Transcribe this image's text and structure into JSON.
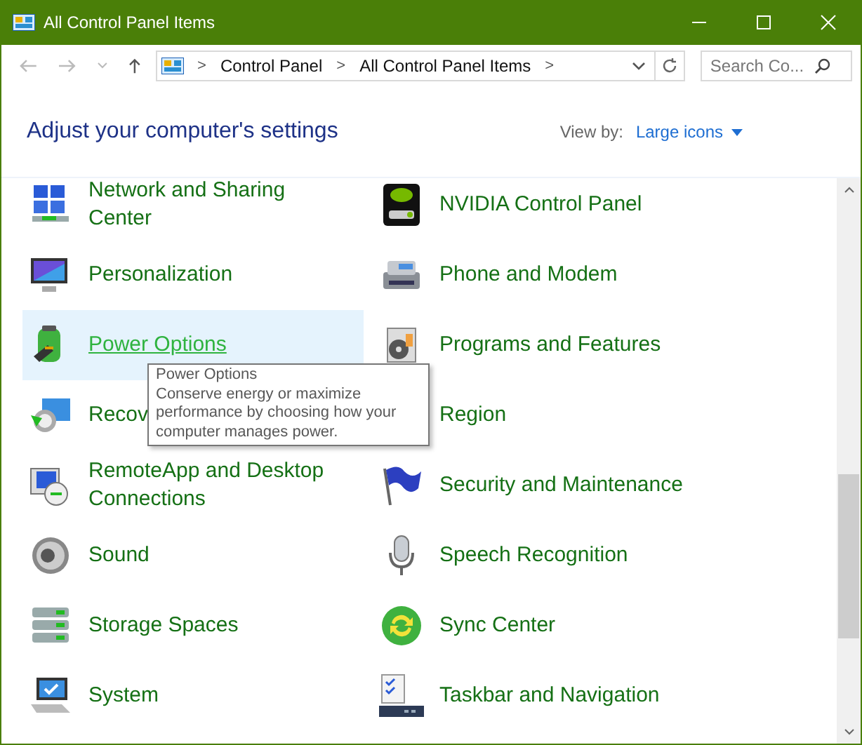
{
  "window": {
    "title": "All Control Panel Items"
  },
  "address": {
    "crumbs": [
      "Control Panel",
      "All Control Panel Items"
    ],
    "separator": ">"
  },
  "search": {
    "placeholder": "Search Co..."
  },
  "header": {
    "title": "Adjust your computer's settings",
    "view_by_label": "View by:",
    "view_by_value": "Large icons"
  },
  "items": [
    {
      "lines": [
        "Network and Sharing",
        "Center"
      ],
      "highlighted": false
    },
    {
      "lines": [
        "NVIDIA Control Panel"
      ],
      "highlighted": false
    },
    {
      "lines": [
        "Personalization"
      ],
      "highlighted": false
    },
    {
      "lines": [
        "Phone and Modem"
      ],
      "highlighted": false
    },
    {
      "lines": [
        "Power Options"
      ],
      "highlighted": true
    },
    {
      "lines": [
        "Programs and Features"
      ],
      "highlighted": false
    },
    {
      "lines": [
        "Recov"
      ],
      "highlighted": false
    },
    {
      "lines": [
        "Region"
      ],
      "highlighted": false
    },
    {
      "lines": [
        "RemoteApp and Desktop",
        "Connections"
      ],
      "highlighted": false
    },
    {
      "lines": [
        "Security and Maintenance"
      ],
      "highlighted": false
    },
    {
      "lines": [
        "Sound"
      ],
      "highlighted": false
    },
    {
      "lines": [
        "Speech Recognition"
      ],
      "highlighted": false
    },
    {
      "lines": [
        "Storage Spaces"
      ],
      "highlighted": false
    },
    {
      "lines": [
        "Sync Center"
      ],
      "highlighted": false
    },
    {
      "lines": [
        "System"
      ],
      "highlighted": false
    },
    {
      "lines": [
        "Taskbar and Navigation"
      ],
      "highlighted": false
    }
  ],
  "tooltip": {
    "title": "Power Options",
    "text": "Conserve energy or maximize performance by choosing how your computer manages power."
  }
}
